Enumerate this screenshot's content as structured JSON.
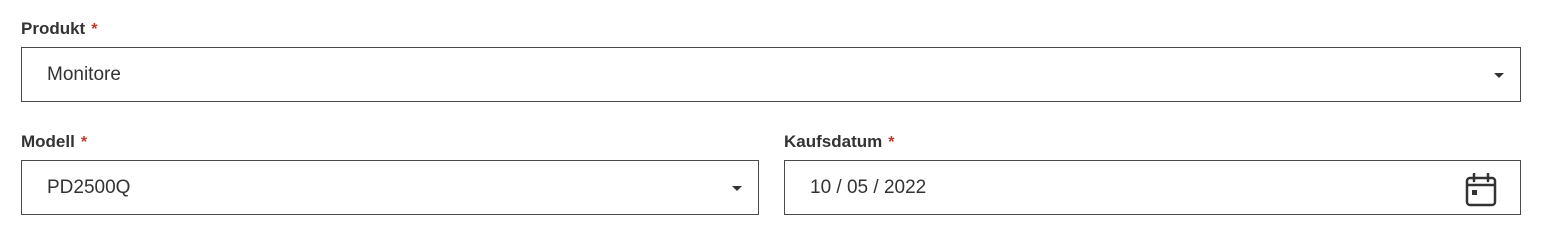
{
  "required_marker": "*",
  "product": {
    "label": "Produkt",
    "value": "Monitore",
    "icon": "chevron-down-icon"
  },
  "model": {
    "label": "Modell",
    "value": "PD2500Q",
    "icon": "chevron-down-icon"
  },
  "purchase_date": {
    "label": "Kaufsdatum",
    "value": "10 / 05 / 2022",
    "icon": "calendar-icon"
  },
  "colors": {
    "required": "#c0392b",
    "border": "#4a4a4a",
    "text": "#333333"
  }
}
